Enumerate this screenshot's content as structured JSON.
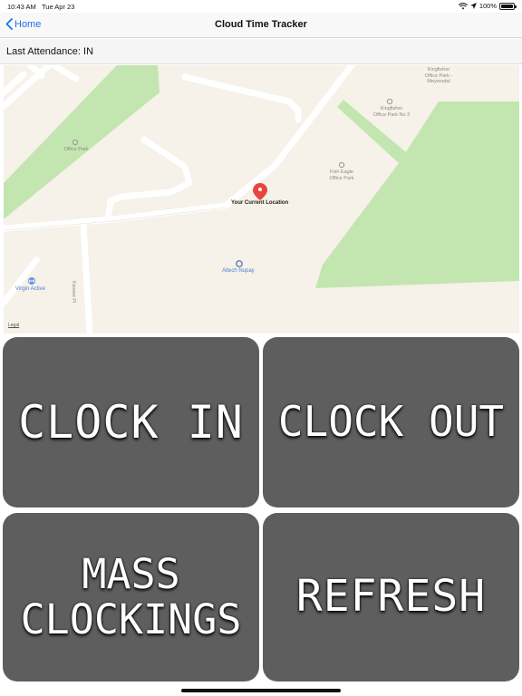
{
  "status_bar": {
    "time": "10:43 AM",
    "date": "Tue Apr 23",
    "battery": "100%",
    "battery_level": 1.0
  },
  "nav": {
    "back_label": "Home",
    "title": "Cloud Time Tracker"
  },
  "attendance": {
    "text": "Last Attendance: IN"
  },
  "map": {
    "labels": {
      "kingfisher_park": [
        "Kingfisher",
        "Office Park -",
        "Meyersdal"
      ],
      "kingfisher_park_2": [
        "Kingfisher",
        "Office Park No 2"
      ],
      "office_park": "Office Park",
      "fish_eagle": [
        "Fish Eagle",
        "Office Park"
      ],
      "current_location": "Your Current Location",
      "altech": "Altech Nupay",
      "virgin": "Virgin Active",
      "kiewiet": "Kiewiet Pl",
      "legal": "Legal"
    },
    "colors": {
      "land": "#f6f1e9",
      "park": "#c3e6b0",
      "road": "#ffffff",
      "pin": "#e8453c"
    },
    "icons": [
      "location-pin-icon",
      "poi-icon",
      "gym-icon"
    ]
  },
  "buttons": {
    "clock_in": "CLOCK IN",
    "clock_out": "CLOCK OUT",
    "mass_line1": "MASS",
    "mass_line2": "CLOCKINGS",
    "refresh": "REFRESH"
  },
  "colors": {
    "accent": "#1a73e8",
    "button_bg": "#5e5e5e",
    "button_text": "#ffffff"
  }
}
